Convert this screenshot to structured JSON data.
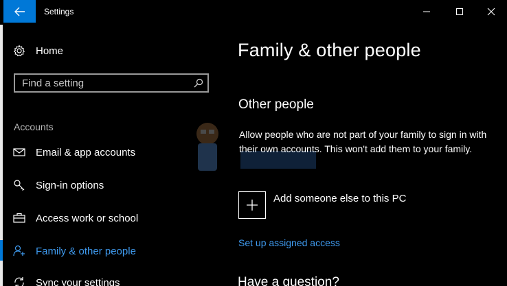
{
  "window": {
    "title": "Settings"
  },
  "sidebar": {
    "home_label": "Home",
    "search_placeholder": "Find a setting",
    "section_label": "Accounts",
    "items": [
      {
        "label": "Email & app accounts",
        "icon": "mail-icon"
      },
      {
        "label": "Sign-in options",
        "icon": "key-icon"
      },
      {
        "label": "Access work or school",
        "icon": "briefcase-icon"
      },
      {
        "label": "Family & other people",
        "icon": "person-add-icon",
        "selected": true
      },
      {
        "label": "Sync your settings",
        "icon": "sync-icon"
      }
    ]
  },
  "main": {
    "title": "Family & other people",
    "other_people_heading": "Other people",
    "description": "Allow people who are not part of your family to sign in with their own accounts. This won't add them to your family.",
    "add_label": "Add someone else to this PC",
    "assigned_access_link": "Set up assigned access",
    "question_heading": "Have a question?"
  },
  "colors": {
    "accent": "#0078d7",
    "link": "#3f9bf0",
    "background": "#000000",
    "text": "#ffffff"
  }
}
